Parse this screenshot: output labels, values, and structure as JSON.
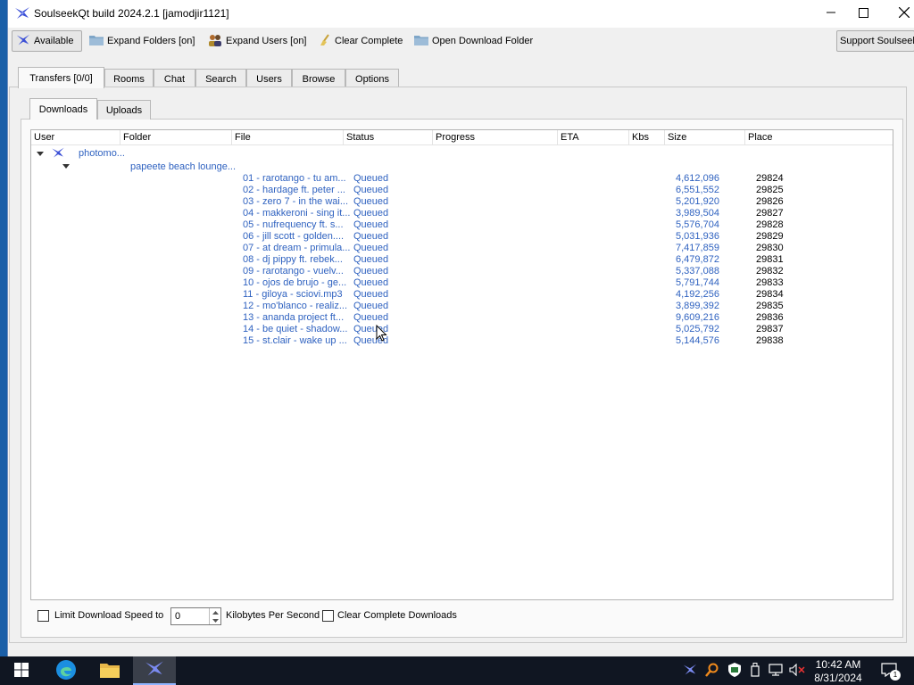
{
  "window": {
    "title": "SoulseekQt build 2024.2.1 [jamodjir1121]"
  },
  "toolbar": {
    "available": "Available",
    "expand_folders": "Expand Folders [on]",
    "expand_users": "Expand Users [on]",
    "clear_complete": "Clear Complete",
    "open_download_folder": "Open Download Folder",
    "support": "Support Soulseek"
  },
  "main_tabs": [
    {
      "label": "Transfers [0/0]",
      "active": true
    },
    {
      "label": "Rooms"
    },
    {
      "label": "Chat"
    },
    {
      "label": "Search"
    },
    {
      "label": "Users"
    },
    {
      "label": "Browse"
    },
    {
      "label": "Options"
    }
  ],
  "sub_tabs": [
    {
      "label": "Downloads",
      "active": true
    },
    {
      "label": "Uploads"
    }
  ],
  "columns": [
    "User",
    "Folder",
    "File",
    "Status",
    "Progress",
    "ETA",
    "Kbs",
    "Size",
    "Place"
  ],
  "user": "photomo...",
  "folder": "papeete beach lounge...",
  "files": [
    {
      "file": "01 - rarotango - tu am...",
      "status": "Queued",
      "size": "4,612,096",
      "place": "29824"
    },
    {
      "file": "02 - hardage ft. peter ...",
      "status": "Queued",
      "size": "6,551,552",
      "place": "29825"
    },
    {
      "file": "03 - zero 7 - in the wai...",
      "status": "Queued",
      "size": "5,201,920",
      "place": "29826"
    },
    {
      "file": "04 - makkeroni - sing it...",
      "status": "Queued",
      "size": "3,989,504",
      "place": "29827"
    },
    {
      "file": "05 - nufrequency ft. s...",
      "status": "Queued",
      "size": "5,576,704",
      "place": "29828"
    },
    {
      "file": "06 - jill scott - golden....",
      "status": "Queued",
      "size": "5,031,936",
      "place": "29829"
    },
    {
      "file": "07 - at dream - primula...",
      "status": "Queued",
      "size": "7,417,859",
      "place": "29830"
    },
    {
      "file": "08 - dj pippy ft. rebek...",
      "status": "Queued",
      "size": "6,479,872",
      "place": "29831"
    },
    {
      "file": "09 - rarotango - vuelv...",
      "status": "Queued",
      "size": "5,337,088",
      "place": "29832"
    },
    {
      "file": "10 - ojos de brujo - ge...",
      "status": "Queued",
      "size": "5,791,744",
      "place": "29833"
    },
    {
      "file": "11 - giloya - sciovi.mp3",
      "status": "Queued",
      "size": "4,192,256",
      "place": "29834"
    },
    {
      "file": "12 - mo'blanco - realiz...",
      "status": "Queued",
      "size": "3,899,392",
      "place": "29835"
    },
    {
      "file": "13 - ananda project ft...",
      "status": "Queued",
      "size": "9,609,216",
      "place": "29836"
    },
    {
      "file": "14 - be quiet - shadow...",
      "status": "Queued",
      "size": "5,025,792",
      "place": "29837"
    },
    {
      "file": "15 - st.clair - wake up ...",
      "status": "Queued",
      "size": "5,144,576",
      "place": "29838"
    }
  ],
  "bottom": {
    "limit_label": "Limit Download Speed to",
    "speed_value": "0",
    "kbps_label": "Kilobytes Per Second",
    "clear_label": "Clear Complete Downloads"
  },
  "taskbar": {
    "time": "10:42 AM",
    "date": "8/31/2024",
    "notification_count": "1"
  },
  "colors": {
    "link_blue": "#2f62c0",
    "taskbar": "#101622",
    "desktop": "#1a5fa8"
  },
  "icons": [
    "soulseek-bird-icon",
    "folder-icon",
    "users-icon",
    "broom-icon",
    "folder-open-icon",
    "minimize-icon",
    "maximize-icon",
    "close-icon",
    "windows-start-icon",
    "edge-icon",
    "file-explorer-icon",
    "search-tray-icon",
    "shield-icon",
    "usb-icon",
    "network-icon",
    "volume-muted-icon",
    "notifications-icon"
  ]
}
